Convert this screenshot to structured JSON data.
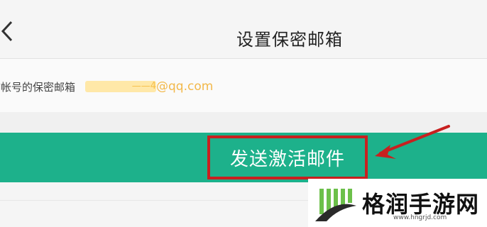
{
  "header": {
    "back_icon": "chevron-left-icon",
    "title": "设置保密邮箱"
  },
  "content": {
    "email_label": "前帐号的保密邮箱",
    "email_masked": "——4",
    "email_domain": "@qq.com"
  },
  "action": {
    "send_label": "发送激活邮件",
    "bar_color": "#1db18b",
    "highlight_color": "#c8201f"
  },
  "watermark": {
    "logo_icon": "leaf-logo-icon",
    "name": "格润手游网",
    "url": "www.hngrjd.com"
  }
}
